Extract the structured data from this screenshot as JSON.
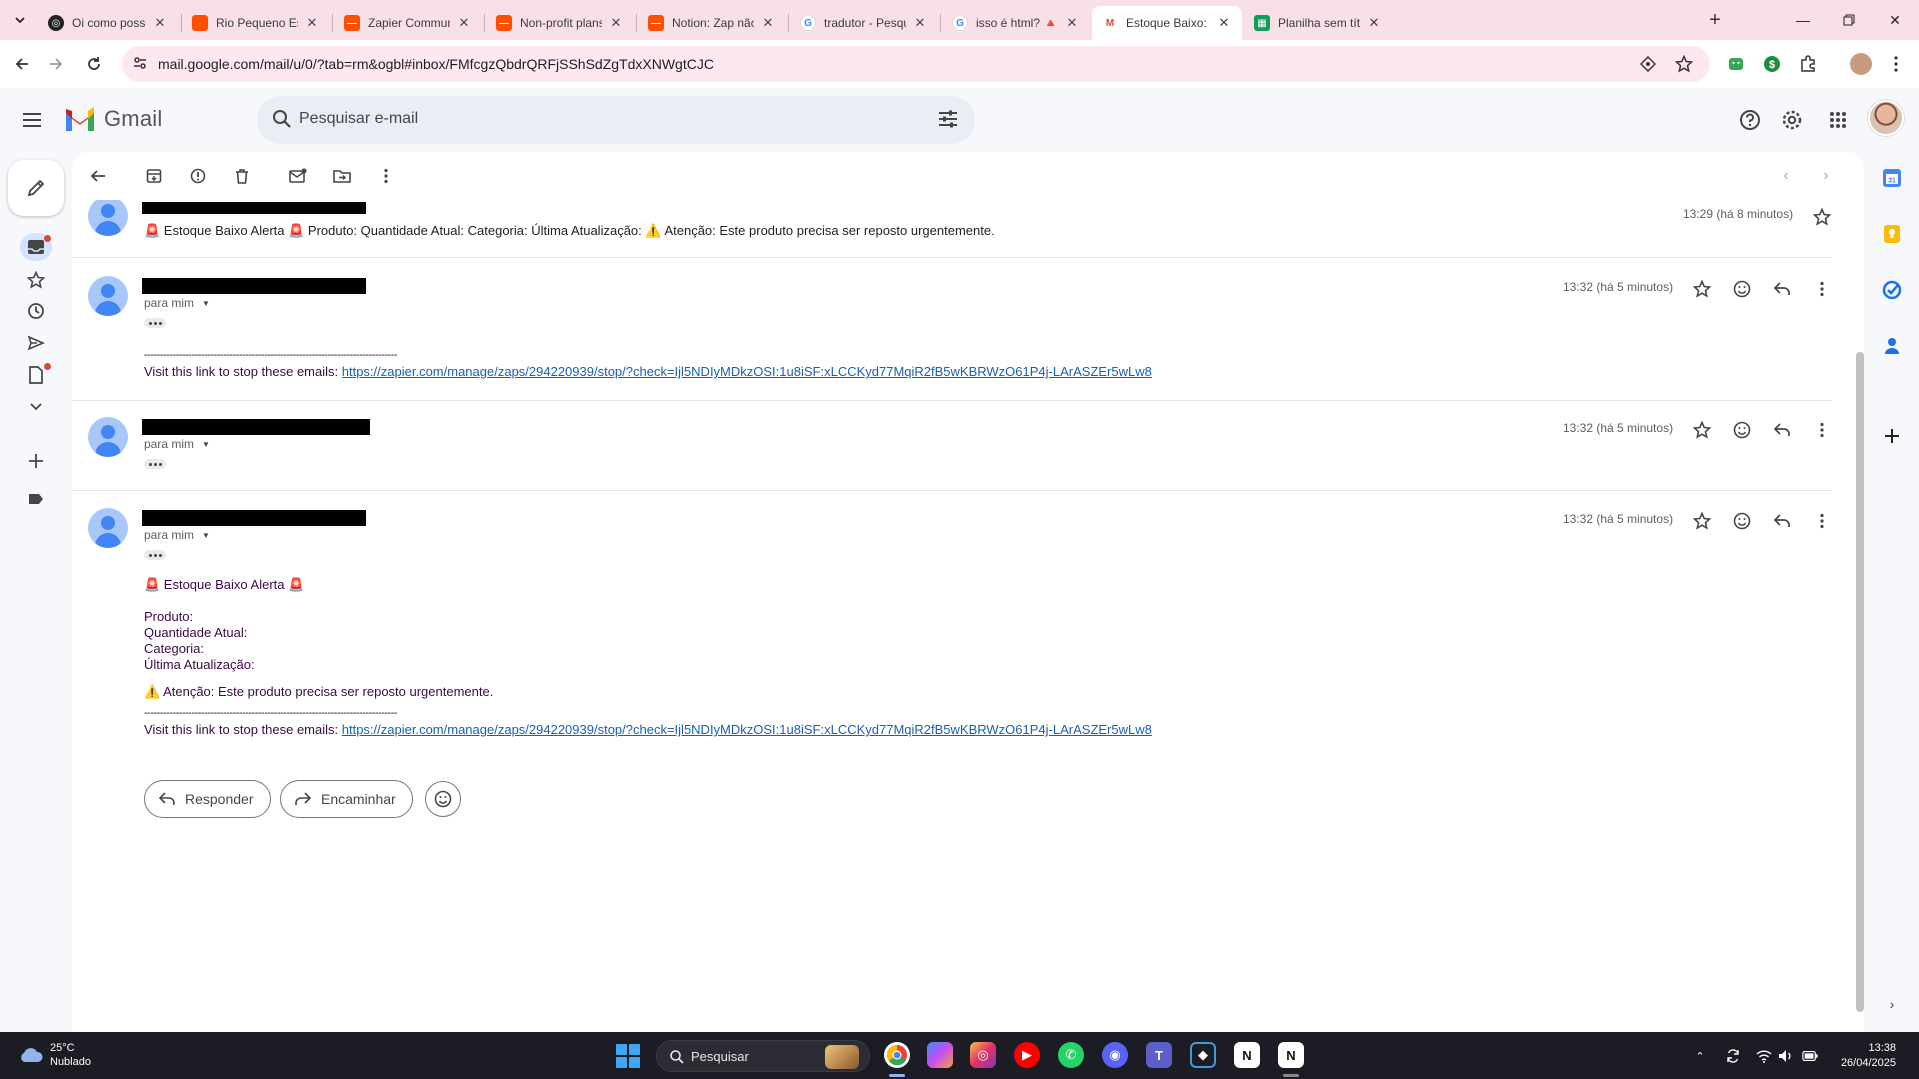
{
  "browser": {
    "tabs": [
      {
        "title": "Oi como posso ajuda",
        "favicon": "chatgpt-icon",
        "color": "#222222",
        "active": false
      },
      {
        "title": "Rio Pequeno Estoque",
        "favicon": "zapier-icon",
        "color": "#ff4f00",
        "active": false
      },
      {
        "title": "Zapier Community: A",
        "favicon": "zapier-icon",
        "color": "#ff4f00",
        "active": false
      },
      {
        "title": "Non-profit plans | Za",
        "favicon": "zapier-icon",
        "color": "#ff4f00",
        "active": false
      },
      {
        "title": "Notion: Zap não cons",
        "favicon": "zapier-icon",
        "color": "#ff4f00",
        "active": false
      },
      {
        "title": "tradutor - Pesquisa G",
        "favicon": "google-icon",
        "color": "#4285f4",
        "active": false
      },
      {
        "title": "isso é html? 🔺 Estoq",
        "favicon": "google-icon",
        "color": "#4285f4",
        "active": false
      },
      {
        "title": "Estoque Baixo: - t",
        "favicon": "gmail-icon",
        "color": "#ea4335",
        "active": true
      },
      {
        "title": "Planilha sem título - I",
        "favicon": "sheets-icon",
        "color": "#0f9d58",
        "active": false
      }
    ],
    "url": "mail.google.com/mail/u/0/?tab=rm&ogbl#inbox/FMfcgzQbdrQRFjSShSdZgTdxXNWgtCJC"
  },
  "gmail": {
    "brand": "Gmail",
    "search_placeholder": "Pesquisar e-mail"
  },
  "thread": {
    "collapsed_first": {
      "time": "13:29 (há 8 minutos)",
      "snippet": "🚨 Estoque Baixo Alerta 🚨 Produto: Quantidade Atual: Categoria: Última Atualização: ⚠️ Atenção: Este produto precisa ser reposto urgentemente."
    },
    "messages": [
      {
        "to": "para mim",
        "time": "13:32 (há 5 minutos)",
        "dashes": "--------------------------------------------------------------------------------",
        "stop_label": "Visit this link to stop these emails: ",
        "stop_link": "https://zapier.com/manage/zaps/294220939/stop/?check=Ijl5NDIyMDkzOSI:1u8iSF:xLCCKyd77MqiR2fB5wKBRWzO61P4j-LArASZEr5wLw8"
      },
      {
        "to": "para mim",
        "time": "13:32 (há 5 minutos)"
      },
      {
        "to": "para mim",
        "time": "13:32 (há 5 minutos)",
        "alert_title": "🚨 Estoque Baixo Alerta 🚨",
        "field_produto": "Produto:",
        "field_quantidade": "Quantidade Atual:",
        "field_categoria": "Categoria:",
        "field_atualizacao": "Última Atualização:",
        "warning": "⚠️ Atenção: Este produto precisa ser reposto urgentemente.",
        "dashes": "--------------------------------------------------------------------------------",
        "stop_label": "Visit this link to stop these emails: ",
        "stop_link": "https://zapier.com/manage/zaps/294220939/stop/?check=Ijl5NDIyMDkzOSI:1u8iSF:xLCCKyd77MqiR2fB5wKBRWzO61P4j-LArASZEr5wLw8"
      }
    ],
    "reply_label": "Responder",
    "forward_label": "Encaminhar"
  },
  "taskbar": {
    "temperature": "25°C",
    "weather": "Nublado",
    "search_label": "Pesquisar",
    "time": "13:38",
    "date": "26/04/2025"
  },
  "colors": {
    "tabstrip": "#f9dfe6",
    "omnibox": "#fde8ee",
    "gmail_bg": "#f6f8fc",
    "link": "#1a5fb4",
    "body_text": "#3b0a45"
  }
}
